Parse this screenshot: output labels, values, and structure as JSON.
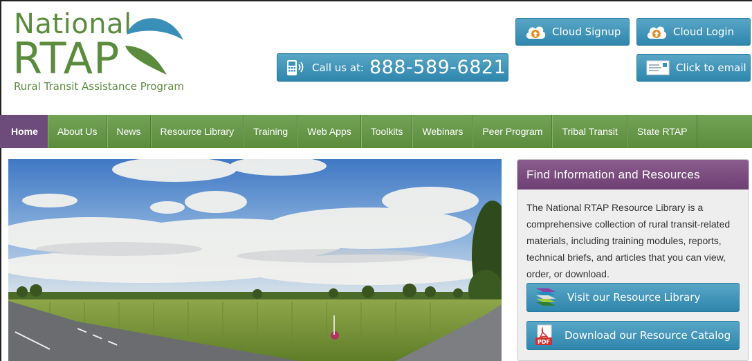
{
  "logo": {
    "line1": "National",
    "line2": "RTAP",
    "tagline": "Rural Transit Assistance Program"
  },
  "header": {
    "call_label": "Call us at:",
    "call_number": "888-589-6821",
    "cloud_signup": "Cloud Signup",
    "cloud_login": "Cloud Login",
    "email": "Click to email"
  },
  "nav": {
    "items": [
      {
        "label": "Home",
        "active": true
      },
      {
        "label": "About Us"
      },
      {
        "label": "News"
      },
      {
        "label": "Resource Library"
      },
      {
        "label": "Training"
      },
      {
        "label": "Web Apps"
      },
      {
        "label": "Toolkits"
      },
      {
        "label": "Webinars"
      },
      {
        "label": "Peer Program"
      },
      {
        "label": "Tribal Transit"
      },
      {
        "label": "State RTAP"
      }
    ]
  },
  "panel": {
    "title": "Find Information and Resources",
    "body": "The National RTAP Resource Library is a comprehensive collection of rural transit-related materials, including training modules, reports, technical briefs, and articles that you can view, order, or download.",
    "library_button": "Visit our Resource Library",
    "catalog_button": "Download our Resource Catalog"
  },
  "icons": {
    "phone": "phone-icon",
    "cloud": "cloud-upload-icon",
    "email": "email-icon",
    "books": "books-icon",
    "pdf": "pdf-icon"
  },
  "colors": {
    "brand_green": "#5b8c3e",
    "nav_active": "#6d4c7c",
    "button_blue": "#3a92b8",
    "panel_header": "#7a4d7e"
  }
}
